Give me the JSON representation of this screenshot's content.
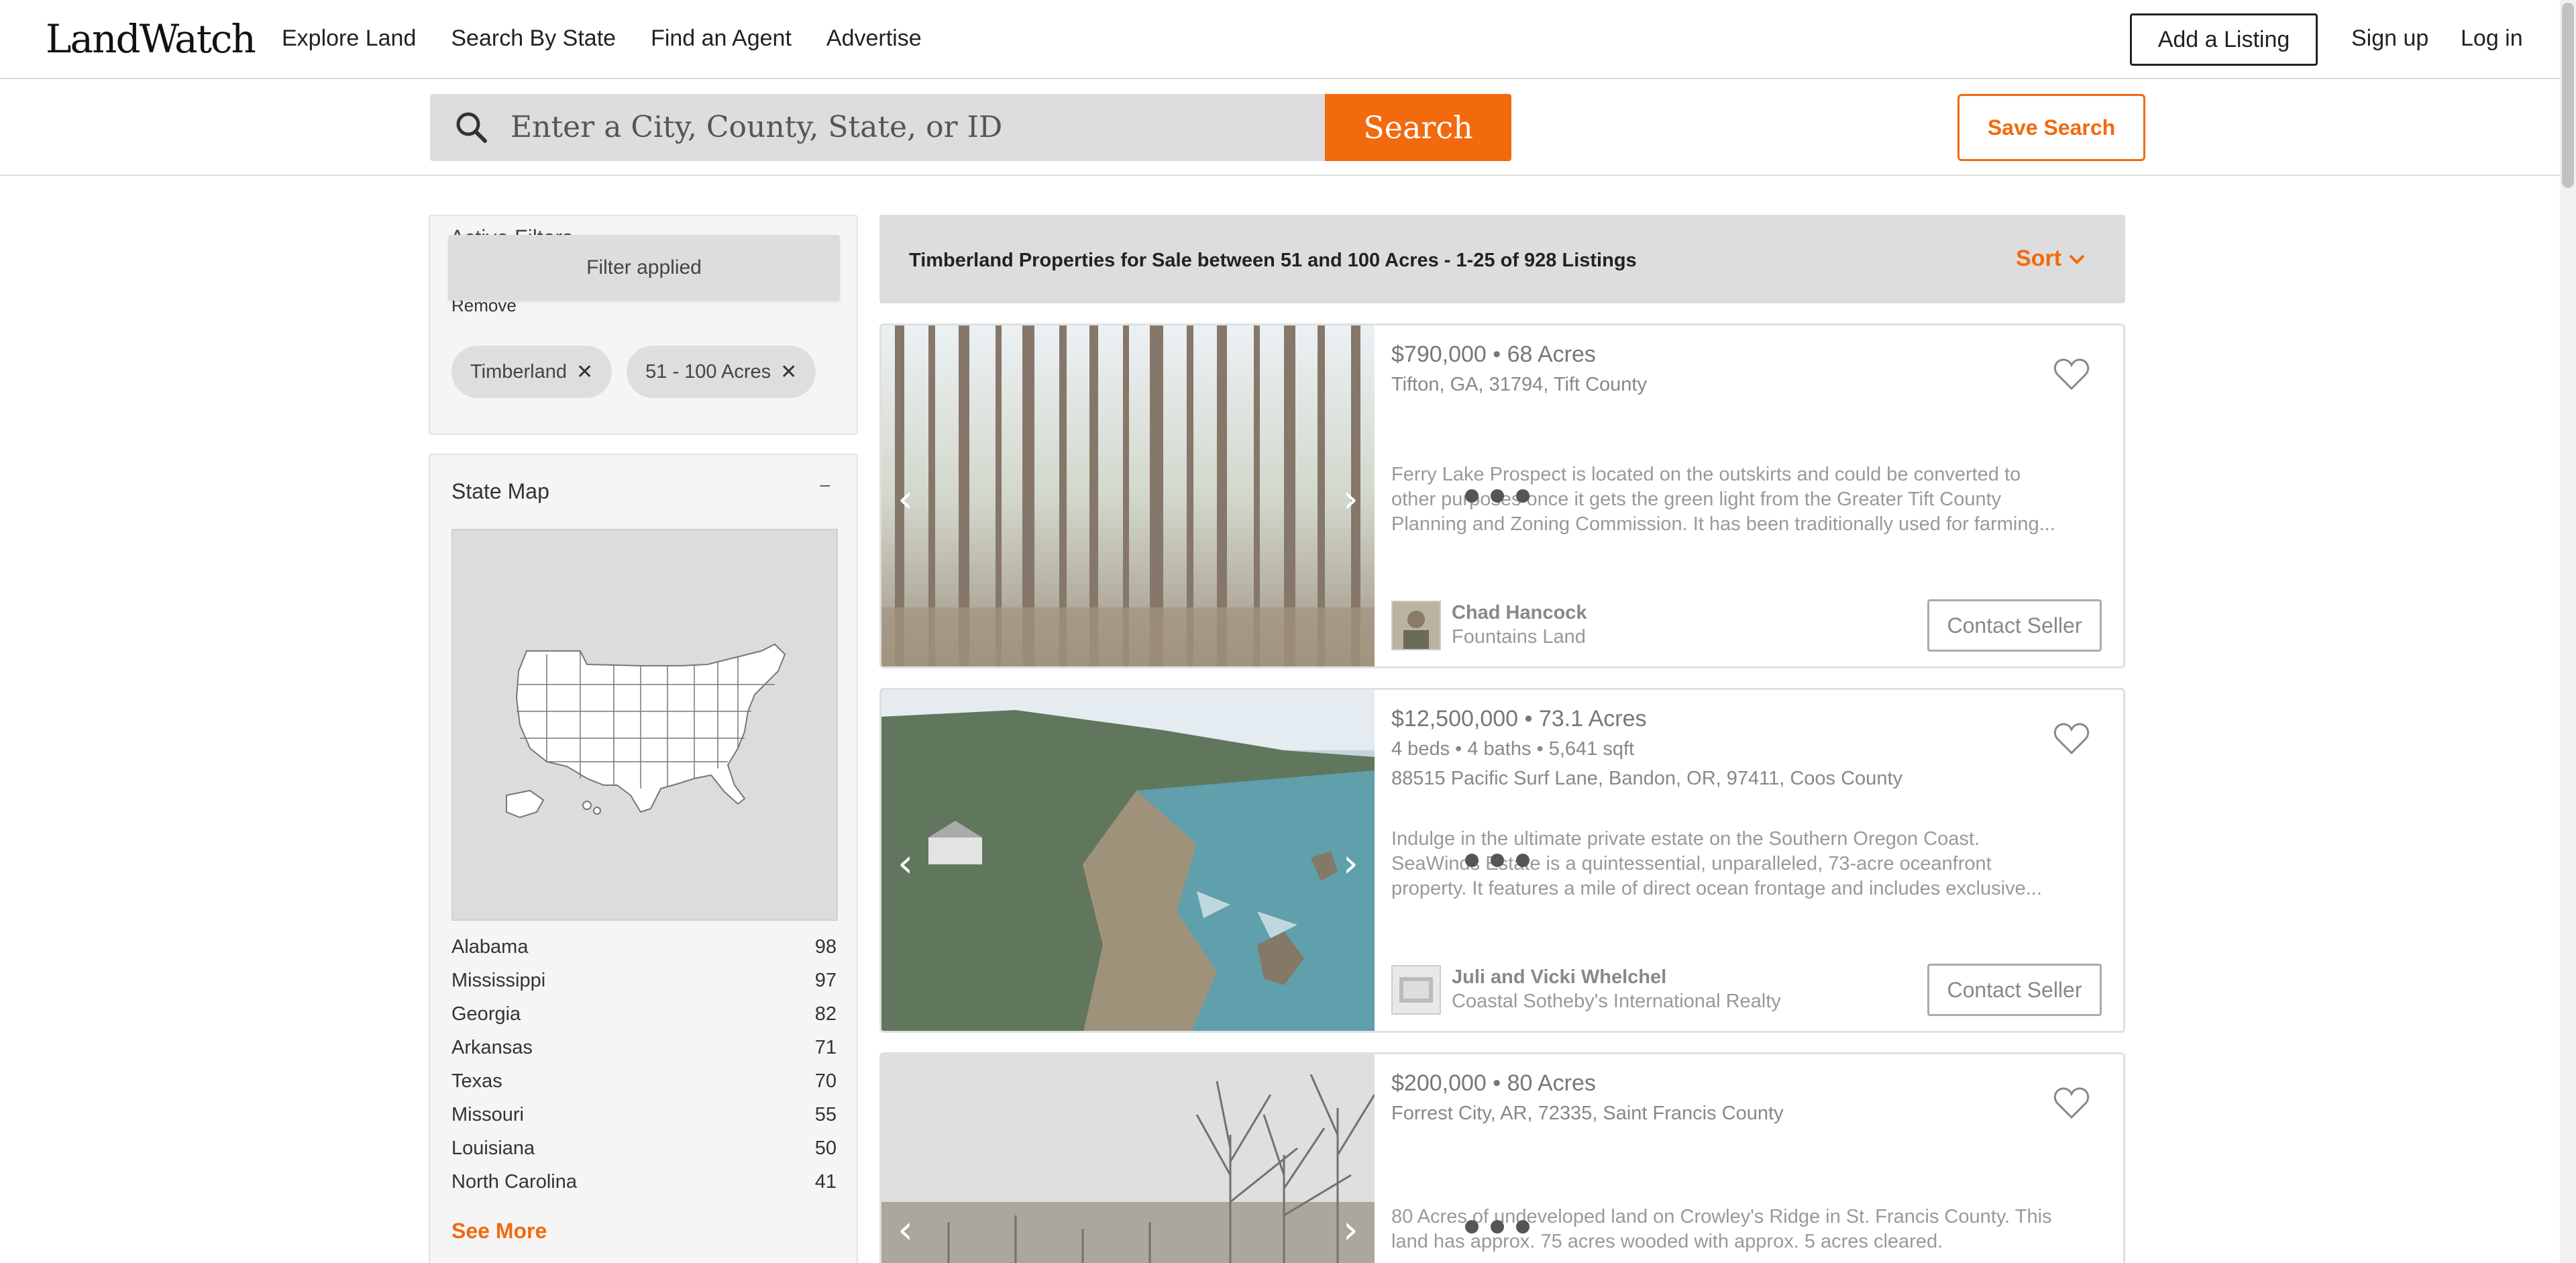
{
  "header": {
    "logo": "LandWatch",
    "nav": [
      "Explore Land",
      "Search By State",
      "Find an Agent",
      "Advertise"
    ],
    "add_listing": "Add a Listing",
    "sign_up": "Sign up",
    "log_in": "Log in"
  },
  "search": {
    "placeholder": "Enter a City, County, State, or ID",
    "button": "Search",
    "save_search": "Save Search"
  },
  "filters": {
    "title": "Active Filters",
    "tooltip": "Filter applied",
    "remove_label": "Remove",
    "chips": [
      "Timberland",
      "51 - 100 Acres"
    ]
  },
  "state_map": {
    "title": "State Map",
    "collapse": "−",
    "states": [
      {
        "name": "Alabama",
        "count": "98"
      },
      {
        "name": "Mississippi",
        "count": "97"
      },
      {
        "name": "Georgia",
        "count": "82"
      },
      {
        "name": "Arkansas",
        "count": "71"
      },
      {
        "name": "Texas",
        "count": "70"
      },
      {
        "name": "Missouri",
        "count": "55"
      },
      {
        "name": "Louisiana",
        "count": "50"
      },
      {
        "name": "North Carolina",
        "count": "41"
      }
    ],
    "see_more": "See More"
  },
  "results": {
    "title": "Timberland Properties for Sale between 51 and 100 Acres - 1-25 of 928 Listings",
    "sort": "Sort"
  },
  "listings": [
    {
      "price_acres": "$790,000 • 68 Acres",
      "details": "",
      "address": "Tifton, GA, 31794, Tift County",
      "description_1": "Ferry Lake Prospect is located on the outskirts and could be converted to",
      "description_2": "other purposes once it gets the green light from the Greater Tift County",
      "description_3": "Planning and Zoning Commission. It has been traditionally used for farming...",
      "agent": "Chad Hancock",
      "company": "Fountains Land",
      "contact": "Contact Seller"
    },
    {
      "price_acres": "$12,500,000 • 73.1 Acres",
      "details": "4 beds • 4 baths • 5,641 sqft",
      "address": "88515 Pacific Surf Lane, Bandon, OR, 97411, Coos County",
      "description_1": "Indulge in the ultimate private estate on the Southern Oregon Coast.",
      "description_2": "SeaWinds Estate is a quintessential, unparalleled, 73-acre oceanfront",
      "description_3": "property. It features a mile of direct ocean frontage and includes exclusive...",
      "agent": "Juli and Vicki Whelchel",
      "company": "Coastal Sotheby's International Realty",
      "contact": "Contact Seller"
    },
    {
      "price_acres": "$200,000 • 80 Acres",
      "details": "",
      "address": "Forrest City, AR, 72335, Saint Francis County",
      "description_1": "80 Acres of undeveloped land on Crowley's Ridge in St. Francis County. This",
      "description_2": "land has approx. 75 acres wooded with approx. 5 acres cleared.",
      "description_3": "",
      "agent": "",
      "company": "",
      "contact": ""
    }
  ],
  "colors": {
    "accent": "#f26a0d",
    "panel_bg": "#f5f5f5",
    "header_bar": "#dddddd"
  }
}
